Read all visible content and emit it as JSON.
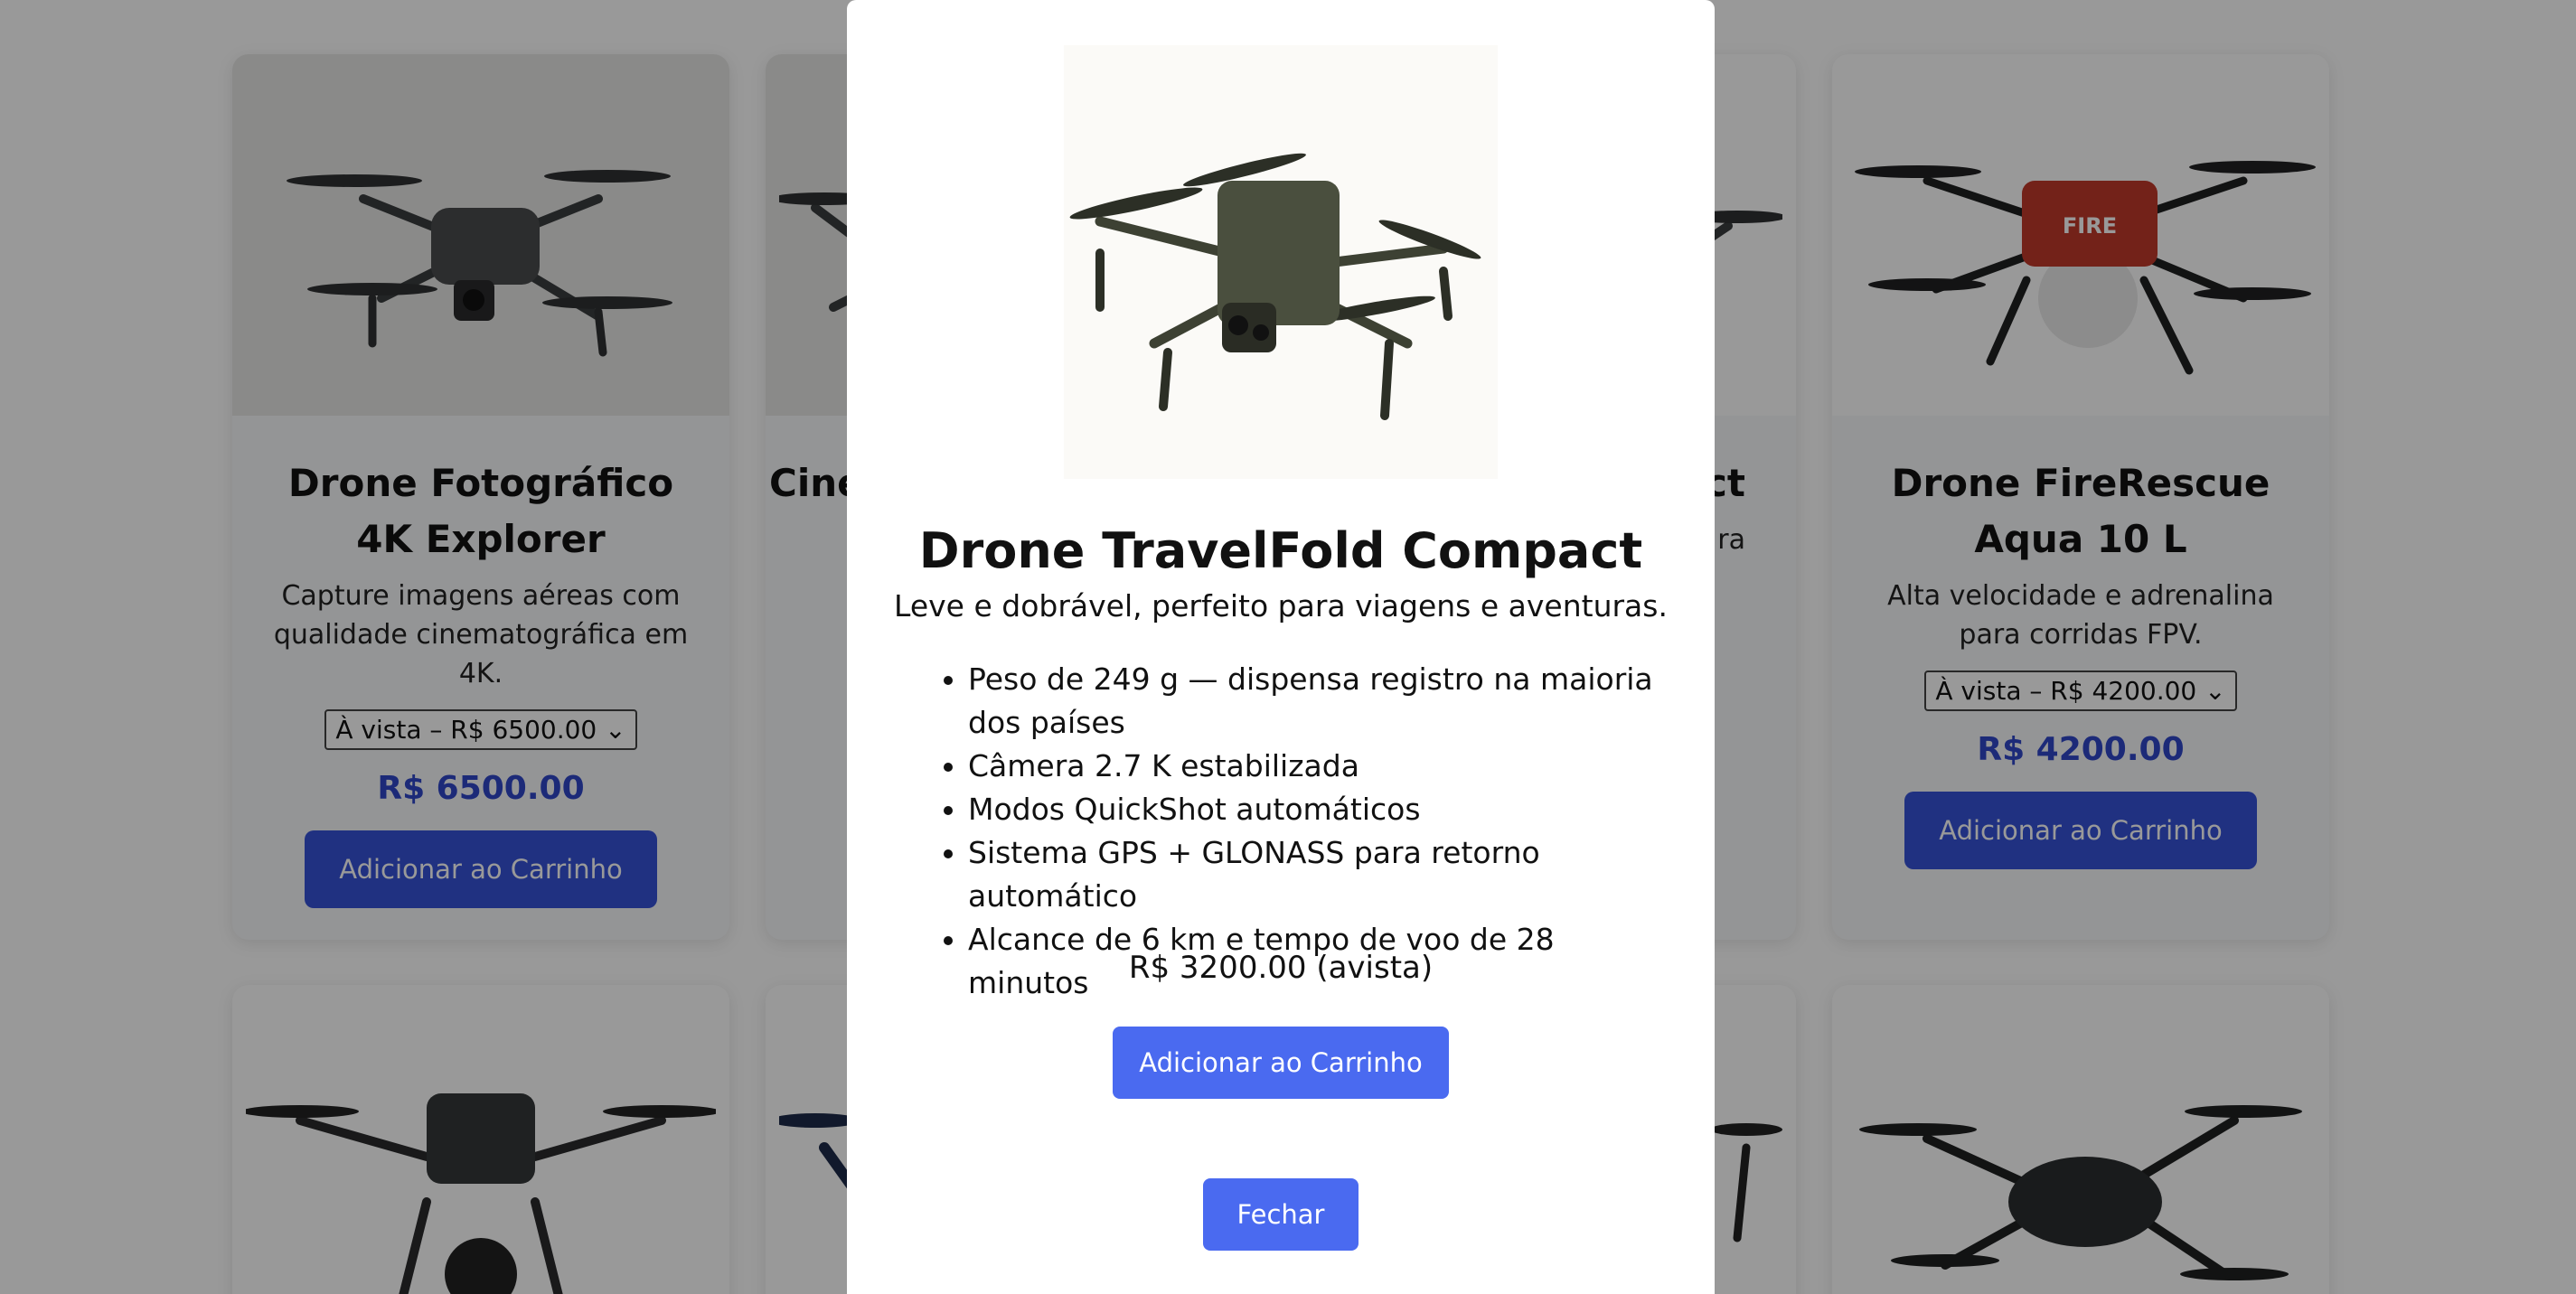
{
  "products": [
    {
      "title": "Drone Fotográfico 4K Explorer",
      "description": "Capture imagens aéreas com qualidade cinematográfica em 4K.",
      "select_value": "À vista – R$ 6500.00",
      "price": "R$ 6500.00",
      "button": "Adicionar ao Carrinho"
    },
    {
      "title": "Cine",
      "description": "",
      "select_value": "",
      "price": "",
      "button": ""
    },
    {
      "title": "ct",
      "description": "ra",
      "select_value": "",
      "price": "",
      "button": ""
    },
    {
      "title": "Drone FireRescue Aqua 10 L",
      "description": "Alta velocidade e adrenalina para corridas FPV.",
      "select_value": "À vista – R$ 4200.00",
      "price": "R$ 4200.00",
      "button": "Adicionar ao Carrinho"
    }
  ],
  "colors": {
    "accent": "#3653d8",
    "modal_button": "#4a6af0",
    "price_text": "#2f47c9"
  },
  "modal": {
    "title": "Drone TravelFold Compact",
    "description": "Leve e dobrável, perfeito para viagens e aventuras.",
    "features": [
      "Peso de 249 g — dispensa registro na maioria dos países",
      "Câmera 2.7 K estabilizada",
      "Modos QuickShot automáticos",
      "Sistema GPS + GLONASS para retorno automático",
      "Alcance de 6 km e tempo de voo de 28 minutos"
    ],
    "price": "R$ 3200.00 (avista)",
    "add_button": "Adicionar ao Carrinho",
    "close_button": "Fechar"
  }
}
